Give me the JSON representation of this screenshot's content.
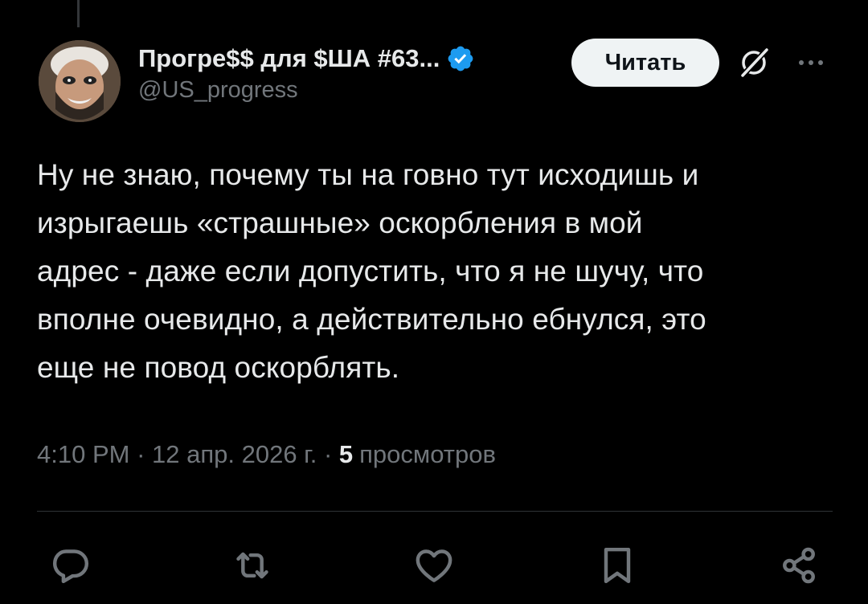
{
  "author": {
    "display_name": "Прогре$$ для $ША #63...",
    "handle": "@US_progress",
    "verified": true
  },
  "follow_button": {
    "label": "Читать"
  },
  "tweet": {
    "text": "Ну не знаю, почему ты на говно тут исходишь и\nизрыгаешь «страшные» оскорбления в мой\nадрес - даже если допустить, что я не шучу, что\nвполне очевидно, а действительно ебнулся, это\nеще не повод оскорблять."
  },
  "meta": {
    "time": "4:10 PM",
    "separator_1": " · ",
    "date": "12 апр. 2026 г.",
    "separator_2": " · ",
    "views_count": "5",
    "views_label": "просмотров"
  },
  "icons": {
    "verified": "verified-badge-icon",
    "grok": "grok-icon",
    "more": "more-dots-icon",
    "reply": "reply-icon",
    "repost": "repost-icon",
    "like": "like-icon",
    "bookmark": "bookmark-icon",
    "share": "share-icon"
  },
  "colors": {
    "background": "#000000",
    "text_primary": "#e7e9ea",
    "text_secondary": "#71767b",
    "verified_blue": "#1d9bf0",
    "follow_button_bg": "#eff3f4",
    "divider": "#2f3336"
  }
}
